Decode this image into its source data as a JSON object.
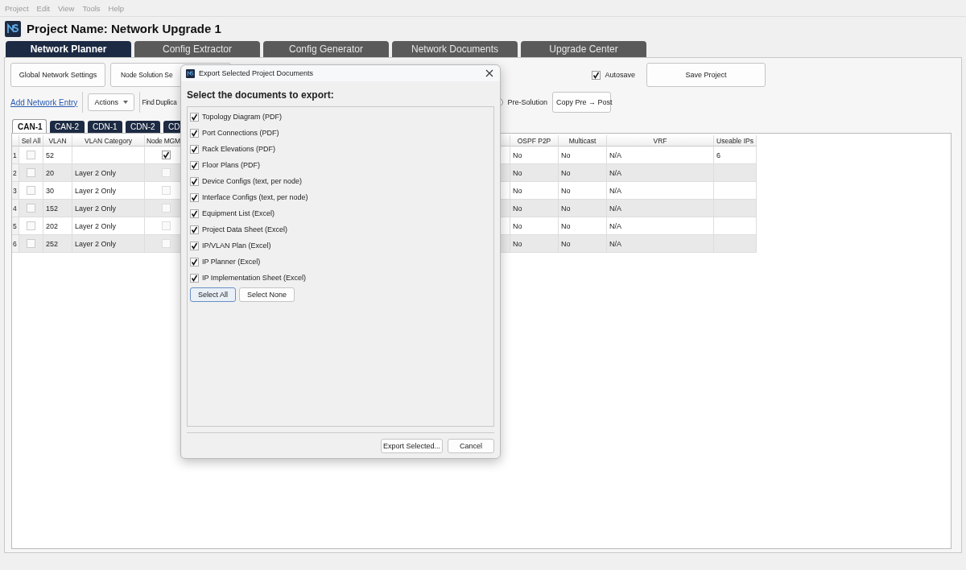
{
  "menu": [
    "Project",
    "Edit",
    "View",
    "Tools",
    "Help"
  ],
  "header": {
    "title": "Project Name: Network Upgrade 1"
  },
  "main_tabs": [
    {
      "label": "Network Planner",
      "selected": true
    },
    {
      "label": "Config Extractor",
      "selected": false
    },
    {
      "label": "Config Generator",
      "selected": false
    },
    {
      "label": "Network Documents",
      "selected": false
    },
    {
      "label": "Upgrade Center",
      "selected": false
    }
  ],
  "toolbar": {
    "buttons": [
      "Global Network Settings",
      "Node Solution Se"
    ],
    "autosave": {
      "label": "Autosave",
      "checked": true
    },
    "save_button": "Save Project"
  },
  "toolbar2": {
    "link": "Add Network Entry",
    "actions": "Actions",
    "find_label": "Find Duplica",
    "radio_label": "Pre-Solution",
    "radio_selected": false,
    "copy_button": "Copy Pre → Post"
  },
  "site_tabs": [
    {
      "label": "CAN-1",
      "selected": true
    },
    {
      "label": "CAN-2",
      "selected": false
    },
    {
      "label": "CDN-1",
      "selected": false
    },
    {
      "label": "CDN-2",
      "selected": false
    },
    {
      "label": "CD",
      "selected": false
    }
  ],
  "table": {
    "columns": [
      "Sel All",
      "VLAN",
      "VLAN Category",
      "Node MGM",
      "OSPF P2P",
      "Multicast",
      "VRF",
      "Useable IPs"
    ],
    "rows": [
      {
        "num": "1",
        "sel": false,
        "vlan": "52",
        "node_mgmt": true,
        "ospf": "No",
        "multicast": "No",
        "vrf": "N/A",
        "useable_ips": "6"
      },
      {
        "num": "2",
        "sel": false,
        "vlan": "20",
        "category": "Layer 2 Only",
        "node_mgmt": false,
        "ospf": "No",
        "multicast": "No",
        "vrf": "N/A"
      },
      {
        "num": "3",
        "sel": false,
        "vlan": "30",
        "category": "Layer 2 Only",
        "node_mgmt": false,
        "ospf": "No",
        "multicast": "No",
        "vrf": "N/A"
      },
      {
        "num": "4",
        "sel": false,
        "vlan": "152",
        "category": "Layer 2 Only",
        "node_mgmt": false,
        "ospf": "No",
        "multicast": "No",
        "vrf": "N/A"
      },
      {
        "num": "5",
        "sel": false,
        "vlan": "202",
        "category": "Layer 2 Only",
        "node_mgmt": false,
        "ospf": "No",
        "multicast": "No",
        "vrf": "N/A"
      },
      {
        "num": "6",
        "sel": false,
        "vlan": "252",
        "category": "Layer 2 Only",
        "node_mgmt": false,
        "ospf": "No",
        "multicast": "No",
        "vrf": "N/A"
      }
    ]
  },
  "dialog": {
    "title": "Export Selected Project Documents",
    "heading": "Select the documents to export:",
    "documents": [
      {
        "label": "Topology Diagram (PDF)",
        "checked": true
      },
      {
        "label": "Port Connections (PDF)",
        "checked": true
      },
      {
        "label": "Rack Elevations (PDF)",
        "checked": true
      },
      {
        "label": "Floor Plans (PDF)",
        "checked": true
      },
      {
        "label": "Device Configs (text, per node)",
        "checked": true
      },
      {
        "label": "Interface Configs (text, per node)",
        "checked": true
      },
      {
        "label": "Equipment List (Excel)",
        "checked": true
      },
      {
        "label": "Project Data Sheet (Excel)",
        "checked": true
      },
      {
        "label": "IP/VLAN Plan (Excel)",
        "checked": true
      },
      {
        "label": "IP Planner (Excel)",
        "checked": true
      },
      {
        "label": "IP Implementation Sheet (Excel)",
        "checked": true
      }
    ],
    "select_all": "Select All",
    "select_none": "Select None",
    "export_button": "Export Selected...",
    "cancel_button": "Cancel"
  }
}
